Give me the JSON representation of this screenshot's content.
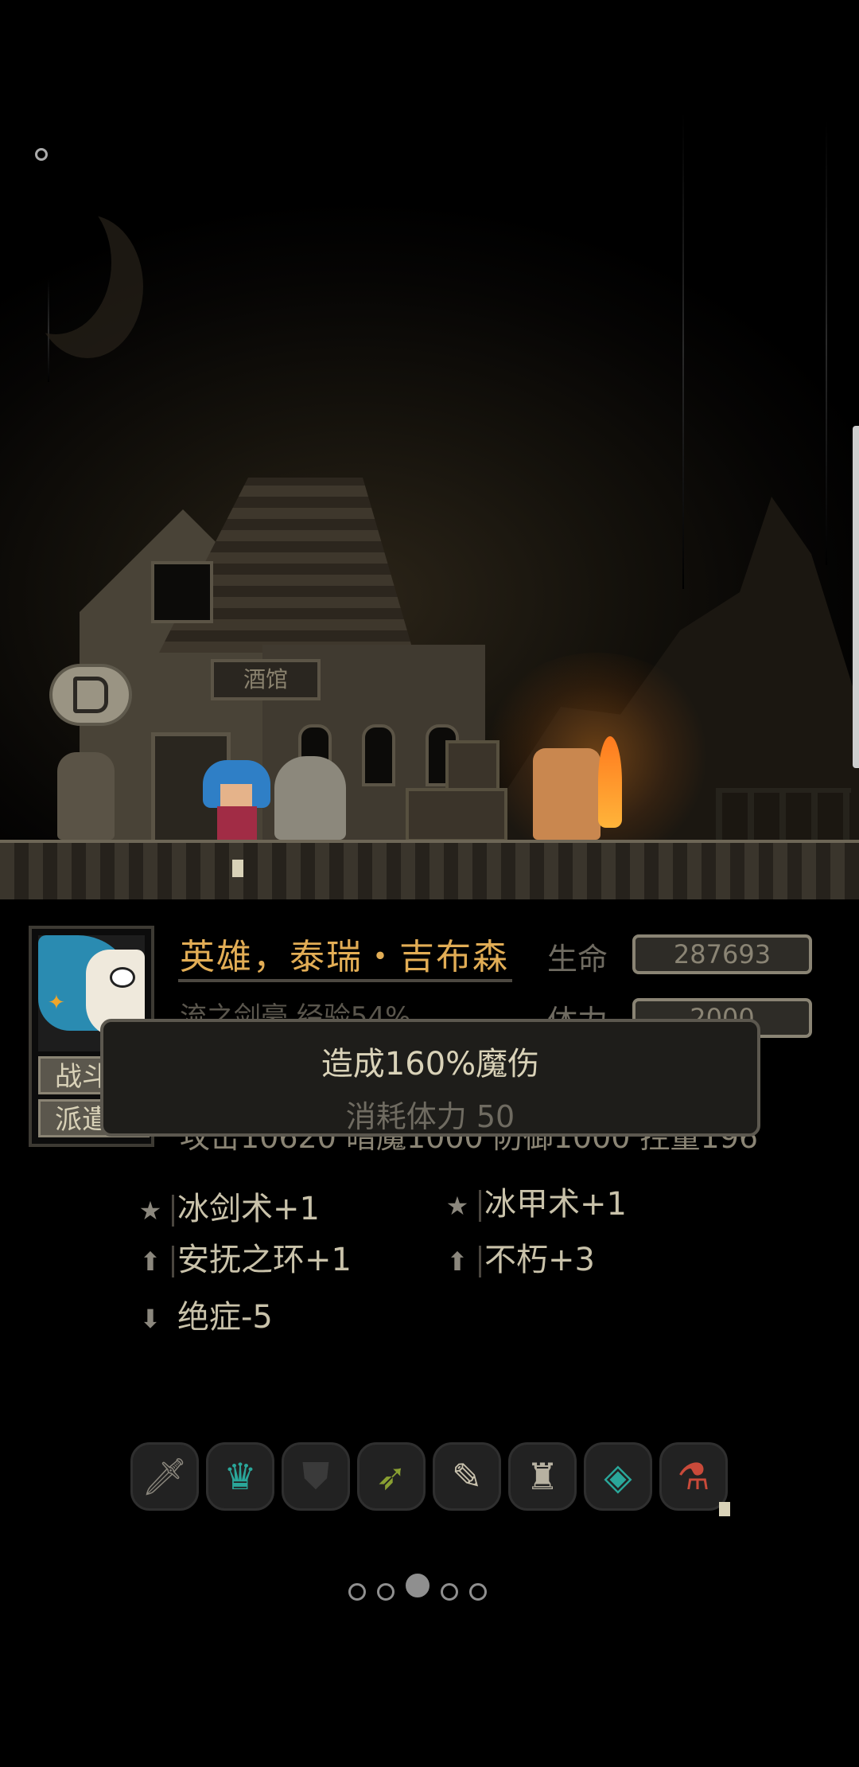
{
  "scene": {
    "tavern_sign": "酒馆"
  },
  "hero": {
    "name": "英雄，泰瑞・吉布森",
    "subtitle": "流之剑豪  经验54%",
    "life_label": "生命",
    "life_value": "287693",
    "stamina_label": "体力",
    "stamina_value": "2000",
    "stats_line": "攻击10620  暗魔1000  防御1000  控量196",
    "tab_battle": "战斗",
    "tab_dispatch": "派遣"
  },
  "tooltip": {
    "line1": "造成160%魔伤",
    "line2": "消耗体力 50"
  },
  "perks": [
    {
      "icon": "star-icon",
      "label": "冰剑术+1"
    },
    {
      "icon": "star-icon",
      "label": "冰甲术+1"
    },
    {
      "icon": "arrow-up-icon",
      "label": "安抚之环+1"
    },
    {
      "icon": "arrow-up-icon",
      "label": "不朽+3"
    },
    {
      "icon": "arrow-down-icon",
      "label": "绝症-5"
    }
  ],
  "equipment": [
    {
      "icon": "sword-icon"
    },
    {
      "icon": "crown-icon"
    },
    {
      "icon": "armor-icon"
    },
    {
      "icon": "boomerang-icon"
    },
    {
      "icon": "scroll-icon"
    },
    {
      "icon": "boots-icon"
    },
    {
      "icon": "amulet-icon"
    },
    {
      "icon": "potion-icon"
    }
  ],
  "pager": {
    "count": 5,
    "active_index": 2
  },
  "colors": {
    "name_gold": "#e2ad55",
    "fire": "#ff7a1e"
  }
}
